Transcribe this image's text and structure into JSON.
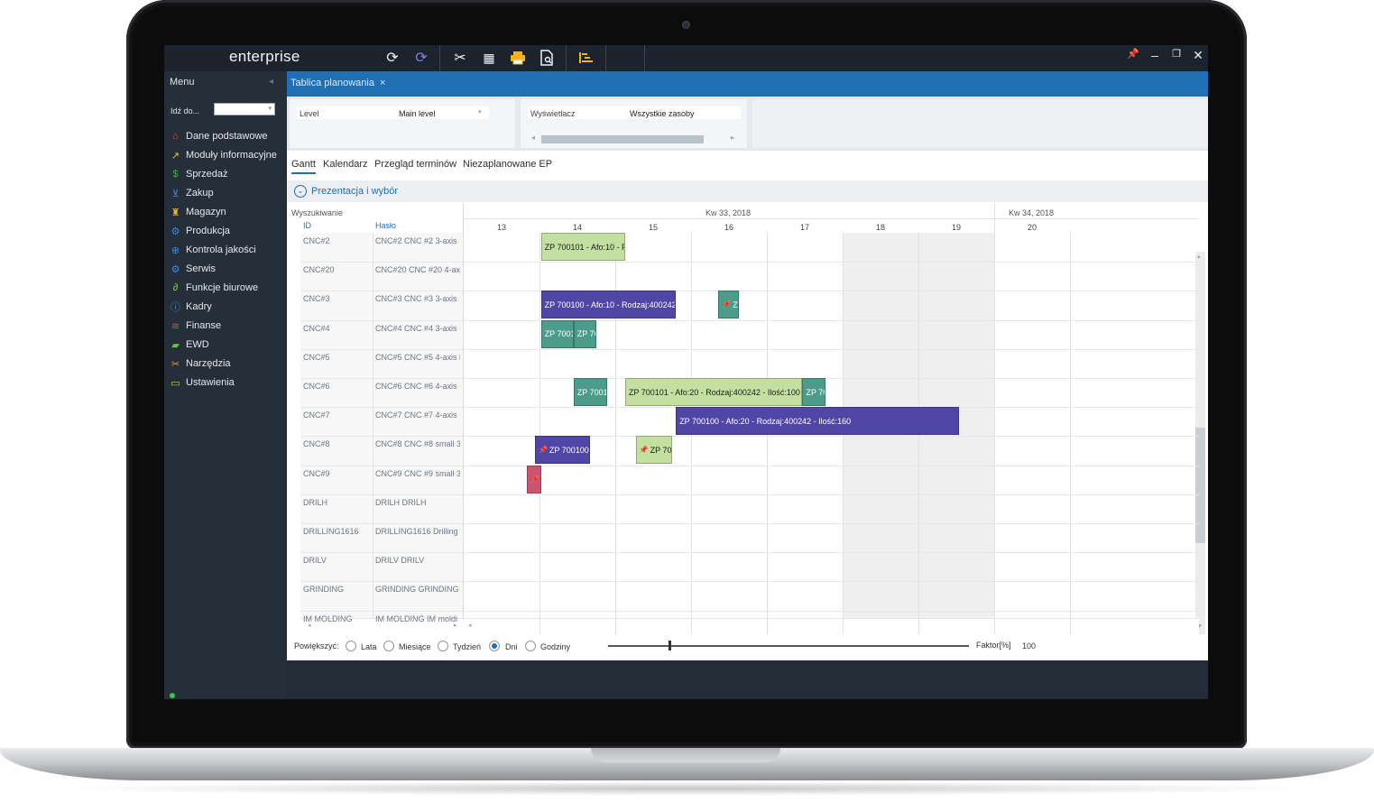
{
  "app": {
    "name": "enterprise"
  },
  "toolbar": {
    "icons": [
      "refresh-icon",
      "sync-icon",
      "tools-icon",
      "calendar-icon",
      "print-icon",
      "document-search-icon",
      "gantt-icon"
    ],
    "window_controls": [
      "pin-icon",
      "minimize-icon",
      "restore-icon",
      "close-icon"
    ]
  },
  "sidebar": {
    "title": "Menu",
    "goto_label": "Idź do...",
    "items": [
      {
        "label": "Dane podstawowe",
        "icon": "home-icon",
        "color": "#e24a3b"
      },
      {
        "label": "Moduły informacyjne",
        "icon": "chart-icon",
        "color": "#f2c230"
      },
      {
        "label": "Sprzedaż",
        "icon": "money-icon",
        "color": "#3fb24b"
      },
      {
        "label": "Zakup",
        "icon": "cart-icon",
        "color": "#3a8ee0"
      },
      {
        "label": "Magazyn",
        "icon": "warehouse-icon",
        "color": "#f2b530"
      },
      {
        "label": "Produkcja",
        "icon": "gears-icon",
        "color": "#3a8ee0"
      },
      {
        "label": "Kontrola jakości",
        "icon": "quality-icon",
        "color": "#3a8ee0"
      },
      {
        "label": "Serwis",
        "icon": "gear-icon",
        "color": "#3a8ee0"
      },
      {
        "label": "Funkcje biurowe",
        "icon": "paperclip-icon",
        "color": "#8fd04a"
      },
      {
        "label": "Kadry",
        "icon": "info-icon",
        "color": "#3a8ee0"
      },
      {
        "label": "Finanse",
        "icon": "finance-icon",
        "color": "#e24a3b"
      },
      {
        "label": "EWD",
        "icon": "folder-icon",
        "color": "#5fc13c"
      },
      {
        "label": "Narzędzia",
        "icon": "tools-icon",
        "color": "#f29a30"
      },
      {
        "label": "Ustawienia",
        "icon": "monitor-icon",
        "color": "#c9d23a"
      }
    ]
  },
  "document_tab": {
    "label": "Tablica planowania",
    "close": "×"
  },
  "filters": {
    "level_label": "Level",
    "level_value": "Main level",
    "display_label": "Wyświetlacz",
    "display_value": "Wszystkie zasoby"
  },
  "view_tabs": [
    "Gantt",
    "Kalendarz",
    "Przegląd terminów",
    "Niezaplanowane EP"
  ],
  "section": {
    "title": "Prezentacja i wybór"
  },
  "gantt": {
    "search_label": "Wyszukiwanie",
    "col_id": "ID",
    "col_keyword": "Hasło",
    "weeks": [
      "Kw 33, 2018",
      "Kw 34, 2018"
    ],
    "days": [
      "13",
      "14",
      "15",
      "16",
      "17",
      "18",
      "19",
      "20"
    ],
    "rows": [
      {
        "id": "CNC#2",
        "keyword": "CNC#2 CNC #2 3-axis"
      },
      {
        "id": "CNC#20",
        "keyword": "CNC#20 CNC #20 4-axi"
      },
      {
        "id": "CNC#3",
        "keyword": "CNC#3 CNC #3 3-axis"
      },
      {
        "id": "CNC#4",
        "keyword": "CNC#4 CNC #4 3-axis"
      },
      {
        "id": "CNC#5",
        "keyword": "CNC#5 CNC #5 4-axis h"
      },
      {
        "id": "CNC#6",
        "keyword": "CNC#6 CNC #6 4-axis"
      },
      {
        "id": "CNC#7",
        "keyword": "CNC#7 CNC #7 4-axis"
      },
      {
        "id": "CNC#8",
        "keyword": "CNC#8 CNC #8 small 3"
      },
      {
        "id": "CNC#9",
        "keyword": "CNC#9 CNC #9 small 3"
      },
      {
        "id": "DRILH",
        "keyword": "DRILH DRILH"
      },
      {
        "id": "DRILLING1616",
        "keyword": "DRILLING1616 Drilling"
      },
      {
        "id": "DRILV",
        "keyword": "DRILV DRILV"
      },
      {
        "id": "GRINDING",
        "keyword": "GRINDING GRINDING"
      },
      {
        "id": "IM MOLDING",
        "keyword": "IM MOLDING IM moldi"
      }
    ],
    "bars": [
      {
        "row": 0,
        "start": 13.52,
        "end": 14.63,
        "label": "ZP 700101 - Afo:10 - F",
        "color": "green",
        "pinned": false
      },
      {
        "row": 2,
        "start": 13.52,
        "end": 15.3,
        "label": "ZP 700100 - Afo:10 - Rodzaj:400242",
        "color": "purple",
        "pinned": false
      },
      {
        "row": 2,
        "start": 15.86,
        "end": 16.13,
        "label": "Z",
        "color": "teal",
        "pinned": true
      },
      {
        "row": 3,
        "start": 13.52,
        "end": 13.95,
        "label": "ZP 7001",
        "color": "teal",
        "pinned": false
      },
      {
        "row": 3,
        "start": 13.95,
        "end": 14.25,
        "label": "ZP 70",
        "color": "teal",
        "pinned": false
      },
      {
        "row": 5,
        "start": 13.95,
        "end": 14.39,
        "label": "ZP 7001",
        "color": "teal",
        "pinned": false
      },
      {
        "row": 5,
        "start": 14.63,
        "end": 16.97,
        "label": "ZP 700101 - Afo:20 - Rodzaj:400242 - Ilość:100",
        "color": "green",
        "pinned": false
      },
      {
        "row": 5,
        "start": 16.97,
        "end": 17.27,
        "label": "ZP 70",
        "color": "teal",
        "pinned": false
      },
      {
        "row": 6,
        "start": 15.3,
        "end": 19.03,
        "label": "ZP 700100 - Afo:20 - Rodzaj:400242 - Ilość:160",
        "color": "purple",
        "pinned": false
      },
      {
        "row": 7,
        "start": 13.44,
        "end": 14.17,
        "label": "ZP 700100",
        "color": "purple",
        "pinned": true
      },
      {
        "row": 7,
        "start": 14.77,
        "end": 15.25,
        "label": "ZP 70",
        "color": "green",
        "pinned": true
      },
      {
        "row": 8,
        "start": 13.33,
        "end": 13.52,
        "label": "",
        "color": "pink",
        "pinned": true
      }
    ]
  },
  "zoom": {
    "label": "Powiększyć:",
    "options": [
      "Lata",
      "Miesiące",
      "Tydzień",
      "Dni",
      "Godziny"
    ],
    "selected": "Dni",
    "factor_label": "Faktor[%]",
    "factor_value": "100",
    "slider_fraction": 0.17
  }
}
